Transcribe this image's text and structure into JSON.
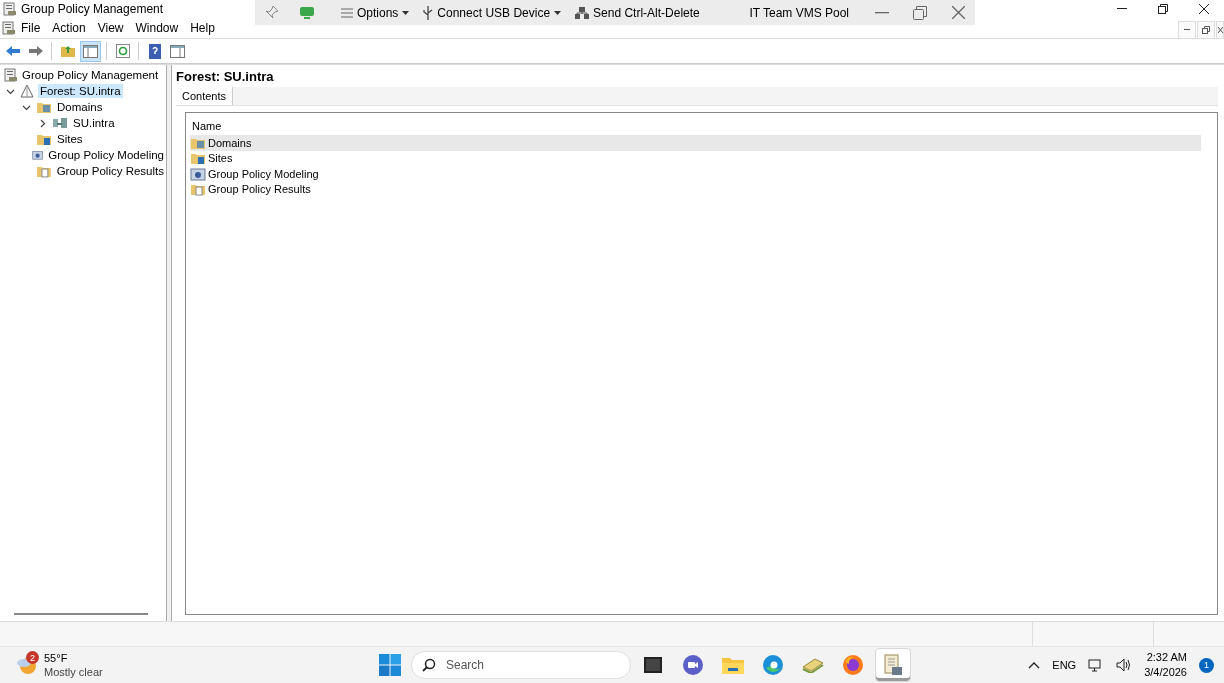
{
  "window": {
    "title": "Group Policy Management"
  },
  "remote_toolbar": {
    "items": [
      {
        "label": "Options",
        "kind": "menu"
      },
      {
        "label": "Connect USB Device",
        "kind": "usb"
      },
      {
        "label": "Send Ctrl-Alt-Delete",
        "kind": "keys"
      }
    ],
    "pool": "IT Team VMS Pool"
  },
  "menu": [
    "File",
    "Action",
    "View",
    "Window",
    "Help"
  ],
  "toolbar": [
    {
      "kind": "back",
      "pressed": false
    },
    {
      "kind": "forward",
      "pressed": false
    },
    {
      "kind": "up",
      "pressed": false
    },
    {
      "kind": "tree",
      "pressed": true
    },
    {
      "kind": "refresh",
      "pressed": false
    },
    {
      "kind": "help",
      "pressed": false
    },
    {
      "kind": "pane",
      "pressed": false
    }
  ],
  "tree": {
    "root": "Group Policy Management",
    "items": [
      {
        "label": "Forest: SU.intra",
        "kind": "forest",
        "expanded": true,
        "selected": true,
        "children": [
          {
            "label": "Domains",
            "kind": "domains",
            "expanded": true,
            "selected": false,
            "children": [
              {
                "label": "SU.intra",
                "kind": "domain",
                "expanded": false,
                "selected": false
              }
            ]
          },
          {
            "label": "Sites",
            "kind": "sites",
            "selected": false
          },
          {
            "label": "Group Policy Modeling",
            "kind": "modeling",
            "selected": false
          },
          {
            "label": "Group Policy Results",
            "kind": "results",
            "selected": false
          }
        ]
      }
    ]
  },
  "content": {
    "title": "Forest: SU.intra",
    "tabs": [
      {
        "label": "Contents",
        "selected": true
      }
    ],
    "columns": [
      "Name"
    ],
    "rows": [
      {
        "name": "Domains",
        "kind": "domains",
        "selected": true
      },
      {
        "name": "Sites",
        "kind": "sites",
        "selected": false
      },
      {
        "name": "Group Policy Modeling",
        "kind": "modeling",
        "selected": false
      },
      {
        "name": "Group Policy Results",
        "kind": "results",
        "selected": false
      }
    ]
  },
  "taskbar": {
    "weather": {
      "temperature": "55°F",
      "condition": "Mostly clear",
      "badge": "2"
    },
    "search": {
      "placeholder": "Search"
    },
    "apps": [
      {
        "kind": "terminal",
        "active": false
      },
      {
        "kind": "chat",
        "active": false
      },
      {
        "kind": "folder",
        "active": false
      },
      {
        "kind": "edge",
        "active": false
      },
      {
        "kind": "money",
        "active": false
      },
      {
        "kind": "firefox",
        "active": false
      },
      {
        "kind": "gpm",
        "active": true
      }
    ],
    "language": "ENG",
    "time": "2:32 AM",
    "date": "3/4/2026",
    "notifications": "1"
  }
}
